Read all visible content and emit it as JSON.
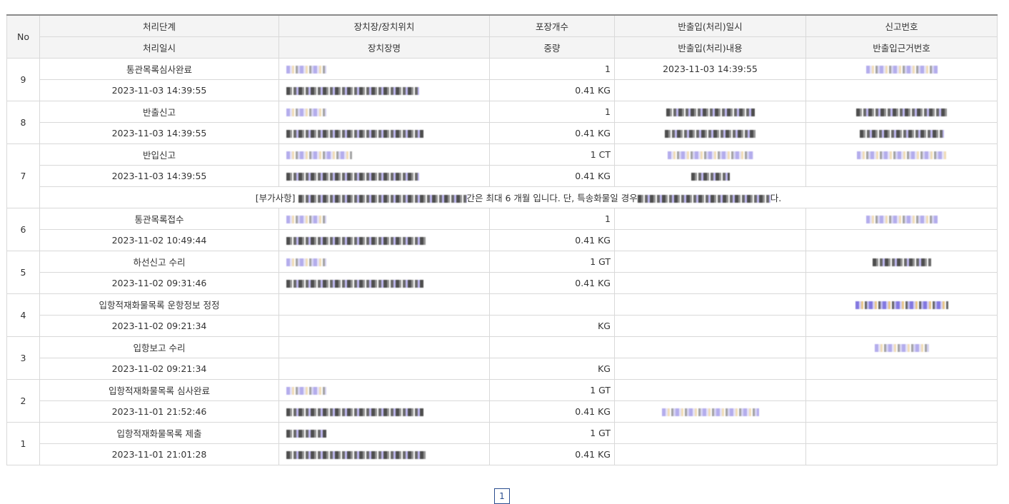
{
  "headers": {
    "no": "No",
    "row1": [
      "처리단계",
      "장치장/장치위치",
      "포장개수",
      "반출입(처리)일시",
      "신고번호"
    ],
    "row2": [
      "처리일시",
      "장치장명",
      "중량",
      "반출입(처리)내용",
      "반출입근거번호"
    ]
  },
  "rows": [
    {
      "no": "9",
      "stage": "통관목록심사완료",
      "datetime": "2023-11-03 14:39:55",
      "count": "1",
      "weight": "0.41 KG",
      "io_datetime": "2023-11-03 14:39:55",
      "io_content": "",
      "has_loc": true,
      "has_report": true,
      "has_basis": false
    },
    {
      "no": "8",
      "stage": "반출신고",
      "datetime": "2023-11-03 14:39:55",
      "count": "1",
      "weight": "0.41 KG",
      "io_datetime": "",
      "io_content": "",
      "has_loc": true,
      "has_report": true,
      "has_basis": true,
      "masked_io": true
    },
    {
      "no": "7",
      "stage": "반입신고",
      "datetime": "2023-11-03 14:39:55",
      "count": "1 CT",
      "weight": "0.41 KG",
      "io_datetime": "",
      "io_content": "",
      "has_loc": true,
      "has_report": true,
      "has_basis": false,
      "masked_io": true
    },
    {
      "no": "6",
      "stage": "통관목록접수",
      "datetime": "2023-11-02 10:49:44",
      "count": "1",
      "weight": "0.41 KG",
      "has_loc": true,
      "has_report": true
    },
    {
      "no": "5",
      "stage": "하선신고 수리",
      "datetime": "2023-11-02 09:31:46",
      "count": "1 GT",
      "weight": "0.41 KG",
      "has_loc": true,
      "has_report": true
    },
    {
      "no": "4",
      "stage": "입항적재화물목록 운항정보 정정",
      "datetime": "2023-11-02 09:21:34",
      "count": "",
      "weight": "KG",
      "has_loc": false,
      "has_report": true
    },
    {
      "no": "3",
      "stage": "입항보고 수리",
      "datetime": "2023-11-02 09:21:34",
      "count": "",
      "weight": "KG",
      "has_loc": false,
      "has_report": true
    },
    {
      "no": "2",
      "stage": "입항적재화물목록 심사완료",
      "datetime": "2023-11-01 21:52:46",
      "count": "1 GT",
      "weight": "0.41 KG",
      "has_loc": true,
      "has_report": false,
      "masked_io_bottom": true
    },
    {
      "no": "1",
      "stage": "입항적재화물목록 제출",
      "datetime": "2023-11-01 21:01:28",
      "count": "1 GT",
      "weight": "0.41 KG",
      "has_loc": true,
      "has_report": false
    }
  ],
  "note": {
    "prefix": "[부가사항]",
    "mid": "간은 최대 6 개월 입니다. 단, 특송화물일 경우",
    "suffix": "다."
  },
  "pager": {
    "current": "1"
  }
}
